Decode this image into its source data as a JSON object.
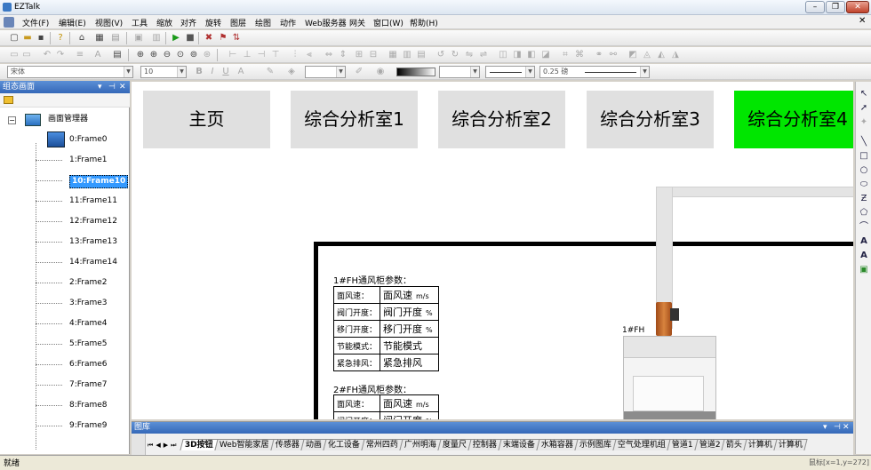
{
  "window": {
    "title": "EZTalk",
    "controls": [
      "–",
      "❐",
      "✕"
    ],
    "menu_close": "✕"
  },
  "menu": [
    "文件(F)",
    "编辑(E)",
    "视图(V)",
    "工具",
    "缩放",
    "对齐",
    "旋转",
    "图层",
    "绘图",
    "动作",
    "Web服务器",
    "网关",
    "窗口(W)",
    "帮助(H)"
  ],
  "format_toolbar": {
    "font_name": "宋体",
    "font_size": "10",
    "line_width": "0.25 磅"
  },
  "left_panel": {
    "title": "组态画面",
    "root_label": "画面管理器",
    "frames": [
      "0:Frame0",
      "1:Frame1",
      "10:Frame10",
      "11:Frame11",
      "12:Frame12",
      "13:Frame13",
      "14:Frame14",
      "2:Frame2",
      "3:Frame3",
      "4:Frame4",
      "5:Frame5",
      "6:Frame6",
      "7:Frame7",
      "8:Frame8",
      "9:Frame9"
    ],
    "selected_index": 2
  },
  "canvas": {
    "nav_buttons": [
      {
        "label": "主页",
        "active": false
      },
      {
        "label": "综合分析室1",
        "active": false
      },
      {
        "label": "综合分析室2",
        "active": false
      },
      {
        "label": "综合分析室3",
        "active": false
      },
      {
        "label": "综合分析室4",
        "active": true
      }
    ],
    "colors": {
      "nav_default": "#e0e0e0",
      "nav_active": "#00e600"
    },
    "section1_title": "1#FH通风柜参数：",
    "section1_rows": [
      {
        "label": "面风速：",
        "value": "面风速",
        "unit": "m/s"
      },
      {
        "label": "阀门开度：",
        "value": "阀门开度",
        "unit": "%"
      },
      {
        "label": "移门开度：",
        "value": "移门开度",
        "unit": "%"
      },
      {
        "label": "节能模式：",
        "value": "节能模式",
        "unit": ""
      },
      {
        "label": "紧急排风：",
        "value": "紧急排风",
        "unit": ""
      }
    ],
    "section2_title": "2#FH通风柜参数：",
    "section2_rows": [
      {
        "label": "面风速：",
        "value": "面风速",
        "unit": "m/s"
      },
      {
        "label": "阀门开度：",
        "value": "阀门开度",
        "unit": "%"
      }
    ],
    "hood_label": "1#FH"
  },
  "library": {
    "title": "图库",
    "close": "✕",
    "nav": [
      "⏮",
      "◀",
      "▶",
      "⏭"
    ],
    "tabs": [
      "3D按钮",
      "Web智能家居",
      "传感器",
      "动画",
      "化工设备",
      "常州四药",
      "广州明海",
      "度量尺",
      "控制器",
      "末端设备",
      "水箱容器",
      "示例图库",
      "空气处理机组",
      "管道1",
      "管道2",
      "箭头",
      "计算机",
      "计算机"
    ],
    "active_tab": 0
  },
  "status": {
    "left": "就绪",
    "right": "鼠标[x=1,y=272]"
  }
}
